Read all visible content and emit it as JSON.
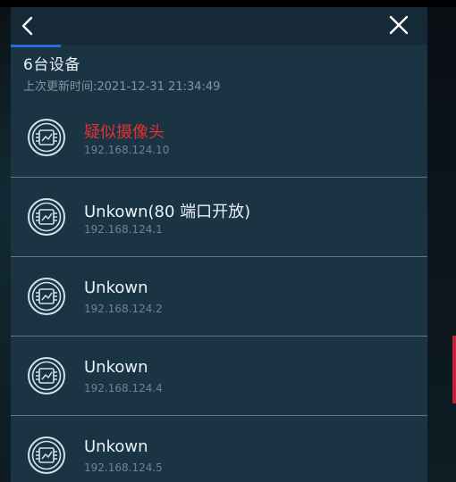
{
  "header": {
    "back_icon": "chevron-left-icon",
    "close_icon": "close-icon"
  },
  "summary": {
    "title": "6台设备",
    "last_update": "上次更新时间:2021-12-31 21:34:49"
  },
  "devices": [
    {
      "name": "疑似摄像头",
      "ip": "192.168.124.10",
      "icon": "network-device-icon",
      "alert": true
    },
    {
      "name": "Unkown(80 端口开放)",
      "ip": "192.168.124.1",
      "icon": "network-device-icon",
      "alert": false
    },
    {
      "name": "Unkown",
      "ip": "192.168.124.2",
      "icon": "network-device-icon",
      "alert": false
    },
    {
      "name": "Unkown",
      "ip": "192.168.124.4",
      "icon": "network-device-icon",
      "alert": false
    },
    {
      "name": "Unkown",
      "ip": "192.168.124.5",
      "icon": "network-device-icon",
      "alert": false
    }
  ],
  "colors": {
    "panel_bg": "#1a3443",
    "alert_text": "#e0322e",
    "accent_tab": "#2a6fd6",
    "icon_teal": "#cfe4ea"
  }
}
